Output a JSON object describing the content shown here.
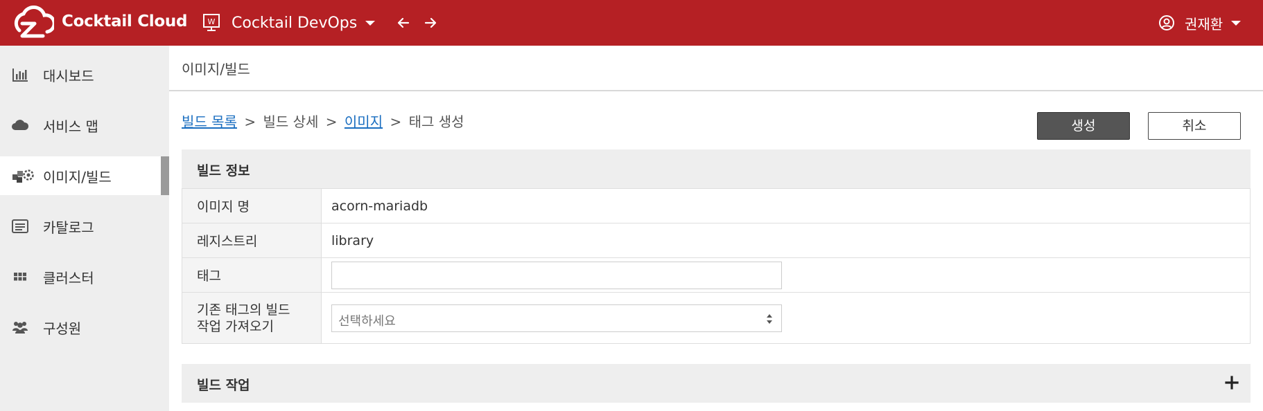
{
  "header": {
    "brand": "Cocktail Cloud",
    "workspace": "Cocktail DevOps",
    "user_name": "권재환"
  },
  "sidebar": {
    "items": [
      {
        "label": "대시보드",
        "icon": "bar-chart-icon"
      },
      {
        "label": "서비스 맵",
        "icon": "cloud-icon"
      },
      {
        "label": "이미지/빌드",
        "icon": "cubes-gear-icon",
        "active": true
      },
      {
        "label": "카탈로그",
        "icon": "list-card-icon"
      },
      {
        "label": "클러스터",
        "icon": "grid-icon"
      },
      {
        "label": "구성원",
        "icon": "users-icon"
      }
    ]
  },
  "page": {
    "title": "이미지/빌드"
  },
  "breadcrumb": {
    "build_list": "빌드 목록",
    "sep1": ">",
    "build_detail": "빌드 상세",
    "sep2": ">",
    "image": "이미지",
    "sep3": ">",
    "create_tag": "태그 생성"
  },
  "actions": {
    "create": "생성",
    "cancel": "취소"
  },
  "build_info": {
    "title": "빌드 정보",
    "rows": {
      "image_name_label": "이미지 명",
      "image_name_value": "acorn-mariadb",
      "registry_label": "레지스트리",
      "registry_value": "library",
      "tag_label": "태그",
      "tag_value": "",
      "import_label_line1": "기존 태그의 빌드",
      "import_label_line2": "작업 가져오기",
      "import_placeholder": "선택하세요"
    }
  },
  "build_jobs": {
    "title": "빌드 작업"
  },
  "colors": {
    "header_bg": "#b52024",
    "sidebar_bg": "#eeeeee",
    "link": "#1a6ec0",
    "create_button": "#555555"
  }
}
